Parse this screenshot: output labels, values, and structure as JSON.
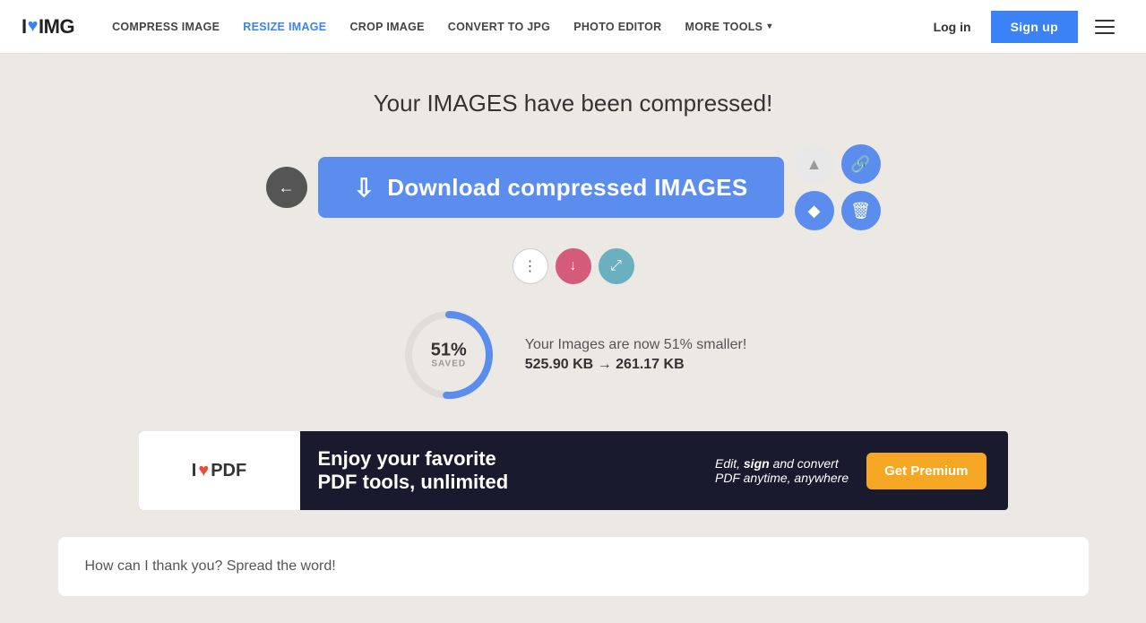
{
  "header": {
    "logo_i": "I",
    "logo_heart": "♥",
    "logo_img": "IMG",
    "nav_items": [
      {
        "label": "COMPRESS IMAGE",
        "active": false
      },
      {
        "label": "RESIZE IMAGE",
        "active": true
      },
      {
        "label": "CROP IMAGE",
        "active": false
      },
      {
        "label": "CONVERT TO JPG",
        "active": false
      },
      {
        "label": "PHOTO EDITOR",
        "active": false
      },
      {
        "label": "MORE TOOLS",
        "has_dropdown": true
      }
    ],
    "login_label": "Log in",
    "signup_label": "Sign up"
  },
  "main": {
    "success_title": "Your IMAGES have been compressed!",
    "download_label": "Download compressed IMAGES",
    "stats": {
      "percent": "51%",
      "saved_label": "SAVED",
      "description": "Your Images are now 51% smaller!",
      "original_size": "525.90 KB",
      "arrow": "→",
      "compressed_size": "261.17 KB",
      "progress_value": 51
    }
  },
  "mini_actions": {
    "more_label": "⋮",
    "download_label": "↓",
    "expand_label": "⤢"
  },
  "share": {
    "drive_icon": "▲",
    "link_icon": "🔗",
    "dropbox_icon": "◆",
    "delete_icon": "🗑"
  },
  "ad": {
    "logo_i": "I",
    "logo_heart": "♥",
    "logo_pdf": "PDF",
    "title_line1": "Enjoy your favorite",
    "title_line2": "PDF tools, unlimited",
    "right_text1": "Edit,",
    "right_text2": "sign",
    "right_text3": "and convert",
    "right_text4": "PDF anytime, anywhere",
    "cta_label": "Get Premium"
  },
  "bottom": {
    "spread_word": "How can I thank you? Spread the word!"
  },
  "colors": {
    "blue": "#5b8dee",
    "dark_nav": "#1a1a2e",
    "orange": "#f5a623"
  }
}
